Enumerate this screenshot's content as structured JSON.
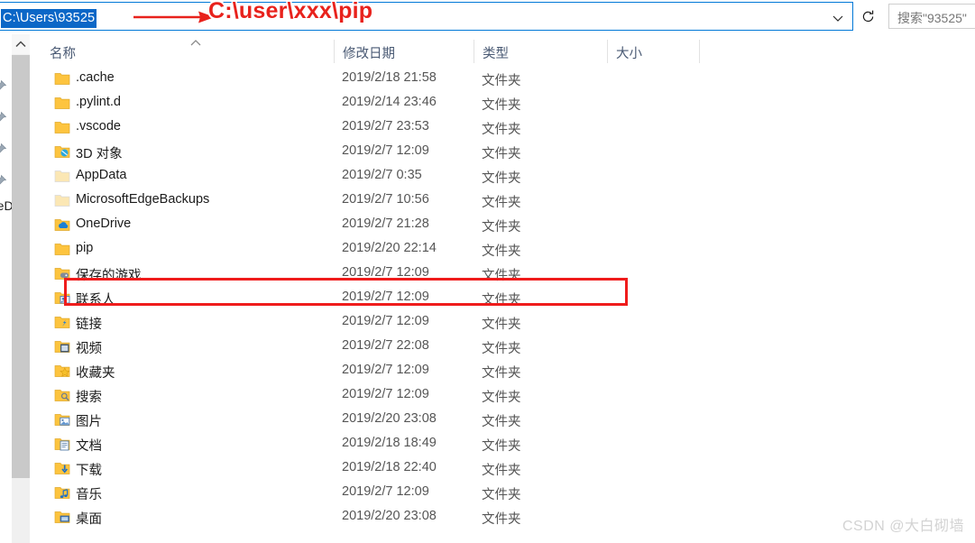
{
  "window": {
    "title": "C:\\Users\\93525"
  },
  "addressbar": {
    "path_text": "C:\\Users\\93525",
    "chevron_icon": "chevron-down-icon",
    "refresh_icon": "refresh-icon"
  },
  "search": {
    "placeholder": "搜索\"93525\""
  },
  "annotation": {
    "arrow_icon": "right-arrow-annotation",
    "text": "C:\\user\\xxx\\pip",
    "color": "#e8221c",
    "highlight_box_color": "#ef1c1c"
  },
  "navpane": {
    "onedrive_label": "OneDrive",
    "pin_icon": "pin-icon"
  },
  "scrollbar": {
    "up_arrow_icon": "chevron-up-icon"
  },
  "columns": {
    "name": "名称",
    "modified": "修改日期",
    "type": "类型",
    "size": "大小",
    "sort_indicator_icon": "sort-ascending-icon"
  },
  "files": [
    {
      "name": ".cache",
      "date": "2019/2/18 21:58",
      "type": "文件夹",
      "icon": "folder-icon"
    },
    {
      "name": ".pylint.d",
      "date": "2019/2/14 23:46",
      "type": "文件夹",
      "icon": "folder-icon"
    },
    {
      "name": ".vscode",
      "date": "2019/2/7 23:53",
      "type": "文件夹",
      "icon": "folder-icon"
    },
    {
      "name": "3D 对象",
      "date": "2019/2/7 12:09",
      "type": "文件夹",
      "icon": "folder-3d-objects-icon"
    },
    {
      "name": "AppData",
      "date": "2019/2/7 0:35",
      "type": "文件夹",
      "icon": "folder-hidden-icon"
    },
    {
      "name": "MicrosoftEdgeBackups",
      "date": "2019/2/7 10:56",
      "type": "文件夹",
      "icon": "folder-hidden-icon"
    },
    {
      "name": "OneDrive",
      "date": "2019/2/7 21:28",
      "type": "文件夹",
      "icon": "folder-onedrive-icon"
    },
    {
      "name": "pip",
      "date": "2019/2/20 22:14",
      "type": "文件夹",
      "icon": "folder-icon"
    },
    {
      "name": "保存的游戏",
      "date": "2019/2/7 12:09",
      "type": "文件夹",
      "icon": "folder-saved-games-icon"
    },
    {
      "name": "联系人",
      "date": "2019/2/7 12:09",
      "type": "文件夹",
      "icon": "folder-contacts-icon"
    },
    {
      "name": "链接",
      "date": "2019/2/7 12:09",
      "type": "文件夹",
      "icon": "folder-links-icon"
    },
    {
      "name": "视频",
      "date": "2019/2/7 22:08",
      "type": "文件夹",
      "icon": "folder-videos-icon"
    },
    {
      "name": "收藏夹",
      "date": "2019/2/7 12:09",
      "type": "文件夹",
      "icon": "folder-favorites-icon"
    },
    {
      "name": "搜索",
      "date": "2019/2/7 12:09",
      "type": "文件夹",
      "icon": "folder-searches-icon"
    },
    {
      "name": "图片",
      "date": "2019/2/20 23:08",
      "type": "文件夹",
      "icon": "folder-pictures-icon"
    },
    {
      "name": "文档",
      "date": "2019/2/18 18:49",
      "type": "文件夹",
      "icon": "folder-documents-icon"
    },
    {
      "name": "下载",
      "date": "2019/2/18 22:40",
      "type": "文件夹",
      "icon": "folder-downloads-icon"
    },
    {
      "name": "音乐",
      "date": "2019/2/7 12:09",
      "type": "文件夹",
      "icon": "folder-music-icon"
    },
    {
      "name": "桌面",
      "date": "2019/2/20 23:08",
      "type": "文件夹",
      "icon": "folder-desktop-icon"
    }
  ],
  "highlighted_row_index": 7,
  "watermark": {
    "text": "CSDN @大白砌墙"
  }
}
